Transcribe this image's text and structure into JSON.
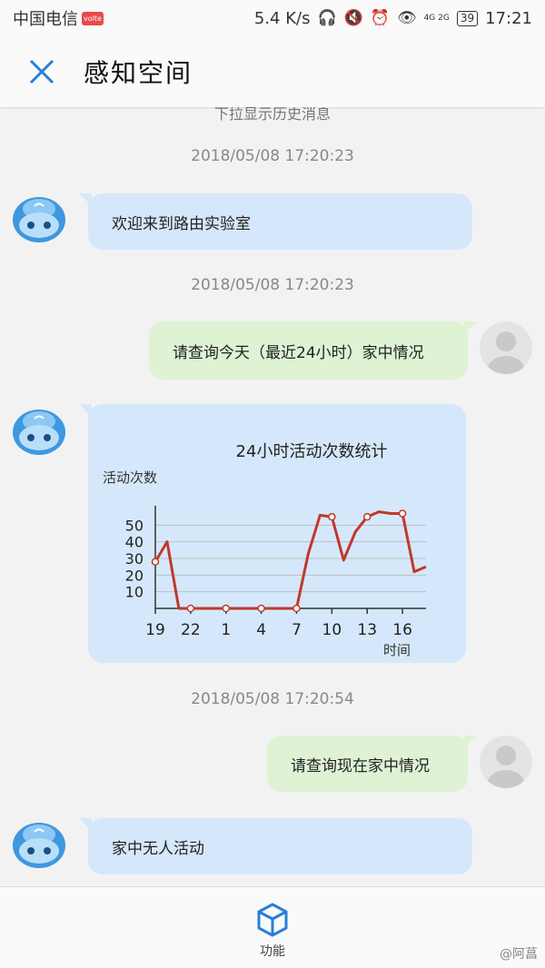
{
  "status_bar": {
    "carrier": "中国电信",
    "carrier_badge": "volte",
    "net_speed": "5.4 K/s",
    "signal_label": "4G 2G",
    "battery": "39",
    "time": "17:21"
  },
  "header": {
    "title": "感知空间"
  },
  "chat": {
    "history_hint": "下拉显示历史消息",
    "messages": [
      {
        "type": "timestamp",
        "text": "2018/05/08 17:20:23"
      },
      {
        "type": "bot",
        "text": "欢迎来到路由实验室"
      },
      {
        "type": "timestamp",
        "text": "2018/05/08 17:20:23"
      },
      {
        "type": "user",
        "text": "请查询今天（最近24小时）家中情况"
      },
      {
        "type": "bot_chart"
      },
      {
        "type": "timestamp",
        "text": "2018/05/08 17:20:54"
      },
      {
        "type": "user",
        "text": "请查询现在家中情况"
      },
      {
        "type": "bot",
        "text": "家中无人活动"
      }
    ]
  },
  "chart_data": {
    "type": "line",
    "title": "24小时活动次数统计",
    "ylabel": "活动次数",
    "xlabel": "时间",
    "x": [
      19,
      20,
      21,
      22,
      23,
      0,
      1,
      2,
      3,
      4,
      5,
      6,
      7,
      8,
      9,
      10,
      11,
      12,
      13,
      14,
      15,
      16,
      17,
      18
    ],
    "values": [
      28,
      40,
      0,
      0,
      0,
      0,
      0,
      0,
      0,
      0,
      0,
      0,
      0,
      33,
      56,
      55,
      29,
      46,
      55,
      58,
      57,
      57,
      22,
      25
    ],
    "markers_at": [
      19,
      22,
      1,
      4,
      7,
      10,
      13,
      16
    ],
    "x_tick_labels": [
      "19",
      "22",
      "1",
      "4",
      "7",
      "10",
      "13",
      "16"
    ],
    "y_ticks": [
      10,
      20,
      30,
      40,
      50
    ],
    "ylim": [
      0,
      60
    ],
    "grid": true,
    "color": "#c0392b"
  },
  "bottom_bar": {
    "function_label": "功能"
  },
  "watermark": "@阿菖",
  "colors": {
    "accent": "#2a7fd8",
    "bot_bubble": "#d5e8fb",
    "user_bubble": "#dff2d4",
    "line": "#c0392b"
  }
}
